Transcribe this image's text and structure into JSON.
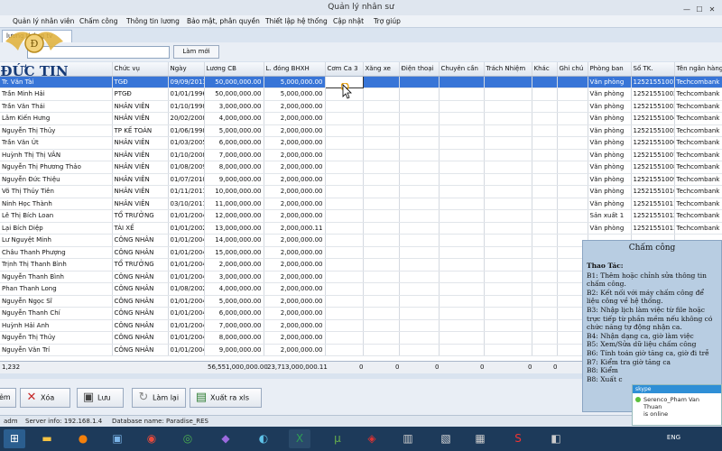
{
  "window": {
    "title": "Quản lý nhân sư"
  },
  "menu": [
    "Quản lý nhân viên",
    "Chấm công",
    "Thông tin lương",
    "Bảo mật, phân quyền",
    "Thiết lập hệ thống",
    "Cập nhật",
    "Trợ giúp"
  ],
  "tab": {
    "label": "lương tháng tv"
  },
  "logo": {
    "text": "ĐỨC TIN"
  },
  "toolbar": {
    "new_label": "Làm mới"
  },
  "grid": {
    "columns": [
      "",
      "Chức vụ",
      "Ngày",
      "Lương CB",
      "L. đóng BHXH",
      "Cơm Ca 3",
      "Xăng xe",
      "Điện thoại",
      "Chuyên cần",
      "Trách Nhiệm",
      "Khác",
      "Ghi chú",
      "Phòng ban",
      "Số TK.",
      "Tên ngân hàng"
    ],
    "rows": [
      [
        "Tr. Văn Tài",
        "TGĐ",
        "09/09/2013",
        "50,000,000.00",
        "5,000,000.00",
        "",
        "",
        "",
        "",
        "",
        "",
        "",
        "Văn phòng",
        "12521551001",
        "Techcombank"
      ],
      [
        "Trần Minh Hải",
        "PTGĐ",
        "01/01/1996",
        "50,000,000.00",
        "5,000,000.00",
        "",
        "",
        "",
        "",
        "",
        "",
        "",
        "Văn phòng",
        "12521551002",
        "Techcombank"
      ],
      [
        "Trần Văn Thái",
        "NHÂN VIÊN",
        "01/10/1998",
        "3,000,000.00",
        "2,000,000.00",
        "",
        "",
        "",
        "",
        "",
        "",
        "",
        "Văn phòng",
        "12521551003",
        "Techcombank"
      ],
      [
        "Lâm Kiến Hưng",
        "NHÂN VIÊN",
        "20/02/2008",
        "4,000,000.00",
        "2,000,000.00",
        "",
        "",
        "",
        "",
        "",
        "",
        "",
        "Văn phòng",
        "12521551004",
        "Techcombank"
      ],
      [
        "Nguyễn Thị Thủy",
        "TP KẾ TOÁN",
        "01/06/1998",
        "5,000,000.00",
        "2,000,000.00",
        "",
        "",
        "",
        "",
        "",
        "",
        "",
        "Văn phòng",
        "12521551005",
        "Techcombank"
      ],
      [
        "Trần Văn Út",
        "NHÂN VIÊN",
        "01/03/2005",
        "6,000,000.00",
        "2,000,000.00",
        "",
        "",
        "",
        "",
        "",
        "",
        "",
        "Văn phòng",
        "12521551006",
        "Techcombank"
      ],
      [
        "Huỳnh Thị Thị VÂN",
        "NHÂN VIÊN",
        "01/10/2008",
        "7,000,000.00",
        "2,000,000.00",
        "",
        "",
        "",
        "",
        "",
        "",
        "",
        "Văn phòng",
        "12521551007",
        "Techcombank"
      ],
      [
        "Nguyễn Thị Phương Thảo",
        "NHÂN VIÊN",
        "01/08/2009",
        "8,000,000.00",
        "2,000,000.00",
        "",
        "",
        "",
        "",
        "",
        "",
        "",
        "Văn phòng",
        "12521551008",
        "Techcombank"
      ],
      [
        "Nguyễn Đức Thiệu",
        "NHÂN VIÊN",
        "01/07/2010",
        "9,000,000.00",
        "2,000,000.00",
        "",
        "",
        "",
        "",
        "",
        "",
        "",
        "Văn phòng",
        "12521551009",
        "Techcombank"
      ],
      [
        "Võ Thị Thủy Tiên",
        "NHÂN VIÊN",
        "01/11/2011",
        "10,000,000.00",
        "2,000,000.00",
        "",
        "",
        "",
        "",
        "",
        "",
        "",
        "Văn phòng",
        "12521551010",
        "Techcombank"
      ],
      [
        "Ninh Học Thành",
        "NHÂN VIÊN",
        "03/10/2011",
        "11,000,000.00",
        "2,000,000.00",
        "",
        "",
        "",
        "",
        "",
        "",
        "",
        "Văn phòng",
        "12521551011",
        "Techcombank"
      ],
      [
        "Lê Thị Bích Loan",
        "TỔ TRƯỞNG",
        "01/01/2004",
        "12,000,000.00",
        "2,000,000.00",
        "",
        "",
        "",
        "",
        "",
        "",
        "",
        "Sản xuất 1",
        "12521551012",
        "Techcombank"
      ],
      [
        "Lại Bích Diệp",
        "TÀI XẾ",
        "01/01/2002",
        "13,000,000.00",
        "2,000,000.11",
        "",
        "",
        "",
        "",
        "",
        "",
        "",
        "Văn phòng",
        "12521551013",
        "Techcombank"
      ],
      [
        "Lư Nguyệt Minh",
        "CÔNG NHÂN",
        "01/01/2004",
        "14,000,000.00",
        "2,000,000.00",
        "",
        "",
        "",
        "",
        "",
        "",
        "",
        "",
        "",
        ""
      ],
      [
        "Châu Thanh Phượng",
        "CÔNG NHÂN",
        "01/01/2004",
        "15,000,000.00",
        "2,000,000.00",
        "",
        "",
        "",
        "",
        "",
        "",
        "",
        "",
        "",
        ""
      ],
      [
        "Trịnh Thị Thanh Bình",
        "TỔ TRƯỞNG",
        "01/01/2004",
        "2,000,000.00",
        "2,000,000.00",
        "",
        "",
        "",
        "",
        "",
        "",
        "",
        "",
        "",
        ""
      ],
      [
        "Nguyễn Thanh Bình",
        "CÔNG NHÂN",
        "01/01/2004",
        "3,000,000.00",
        "2,000,000.00",
        "",
        "",
        "",
        "",
        "",
        "",
        "",
        "",
        "",
        ""
      ],
      [
        "Phan Thanh Long",
        "CÔNG NHÂN",
        "01/08/2002",
        "4,000,000.00",
        "2,000,000.00",
        "",
        "",
        "",
        "",
        "",
        "",
        "",
        "",
        "",
        ""
      ],
      [
        "Nguyễn Ngọc Sĩ",
        "CÔNG NHÂN",
        "01/01/2004",
        "5,000,000.00",
        "2,000,000.00",
        "",
        "",
        "",
        "",
        "",
        "",
        "",
        "",
        "",
        ""
      ],
      [
        "Nguyễn Thanh Chí",
        "CÔNG NHÂN",
        "01/01/2004",
        "6,000,000.00",
        "2,000,000.00",
        "",
        "",
        "",
        "",
        "",
        "",
        "",
        "",
        "",
        ""
      ],
      [
        "Huỳnh Hải Anh",
        "CÔNG NHÂN",
        "01/01/2004",
        "7,000,000.00",
        "2,000,000.00",
        "",
        "",
        "",
        "",
        "",
        "",
        "",
        "",
        "",
        ""
      ],
      [
        "Nguyễn Thị Thủy",
        "CÔNG NHÂN",
        "01/01/2004",
        "8,000,000.00",
        "2,000,000.00",
        "",
        "",
        "",
        "",
        "",
        "",
        "",
        "",
        "",
        ""
      ],
      [
        "Nguyễn Văn Trí",
        "CÔNG NHÂN",
        "01/01/2004",
        "9,000,000.00",
        "2,000,000.00",
        "",
        "",
        "",
        "",
        "",
        "",
        "",
        "",
        "",
        ""
      ]
    ],
    "footer": {
      "count": "1,232",
      "luong_cb": "56,551,000,000.00",
      "bhxh": "23,713,000,000.11",
      "zeros": [
        "0",
        "0",
        "0",
        "0",
        "0",
        "0"
      ]
    }
  },
  "buttons": {
    "delete_partial": "ẻm",
    "delete": "Xóa",
    "save": "Lưu",
    "redo": "Làm lại",
    "export": "Xuất ra xls"
  },
  "status": {
    "user": "adm",
    "server": "Server info: 192.168.1.4",
    "database": "Database name: Paradise_RES"
  },
  "tooltip": {
    "title": "Chấm công",
    "sub": "Thao Tác:",
    "lines": [
      "B1: Thêm hoặc chỉnh sửa thông tin chấm công.",
      "B2: Kết nối với máy chấm công để liệu công về hệ thống.",
      "B3: Nhập lịch làm việc từ file hoặc trực tiếp từ phần mềm nếu không có chức năng tự động nhận ca.",
      "B4: Nhận dạng ca, giờ làm việc",
      "B5: Xem/Sửa dữ liệu chấm công",
      "B6: Tính toán giờ tăng ca, giờ đi trễ",
      "B7: Kiểm tra giờ tăng ca",
      "B8: Kiểm",
      "B8: Xuất c"
    ]
  },
  "skype": {
    "brand": "skype",
    "name": "Serenco_Pham Van Thuan",
    "status": "is online"
  },
  "taskbar": {
    "lang": "ENG"
  }
}
